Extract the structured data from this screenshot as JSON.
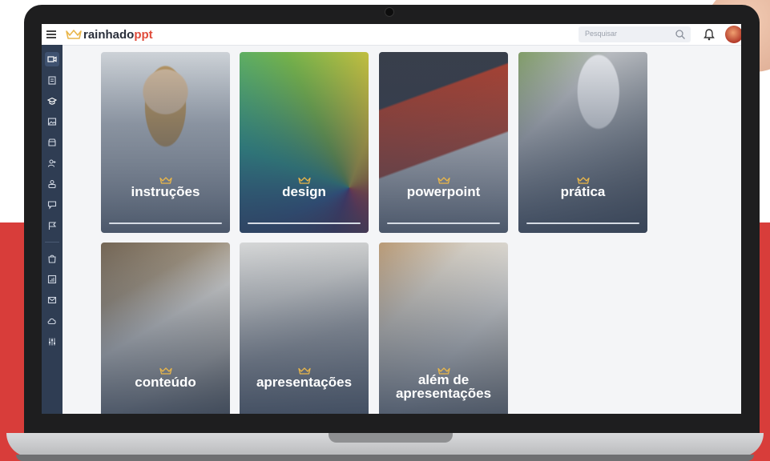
{
  "app": {
    "logo_part1": "rainhado",
    "logo_part2": "ppt"
  },
  "topbar": {
    "search_placeholder": "Pesquisar"
  },
  "sidebar": {
    "icons": [
      "video-icon",
      "clipboard-icon",
      "graduation-cap-icon",
      "image-icon",
      "archive-icon",
      "add-user-icon",
      "users-icon",
      "chat-icon",
      "flag-icon",
      "bag-icon",
      "chart-icon",
      "mail-icon",
      "cloud-icon",
      "sliders-icon"
    ]
  },
  "cards": [
    {
      "title": "instruções"
    },
    {
      "title": "design"
    },
    {
      "title": "powerpoint"
    },
    {
      "title": "prática"
    },
    {
      "title": "conteúdo"
    },
    {
      "title": "apresentações"
    },
    {
      "title": "além de\napresentações"
    }
  ],
  "colors": {
    "brand_red": "#e04b3a",
    "sidebar": "#2f3d53",
    "accent_gold": "#e9b64a"
  }
}
